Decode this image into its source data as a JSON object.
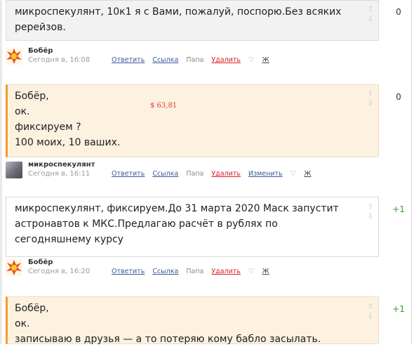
{
  "comments": [
    {
      "text_lines": [
        "микроспекулянт, 10к1 я с Вами, пожалуй, поспорю.Без всяких",
        "ререйзов."
      ],
      "score": "0"
    },
    {
      "author": "Бобёр",
      "date": "Сегодня в, 16:08",
      "actions": {
        "reply": "Ответить",
        "link": "Ссылка",
        "parent": "Папа",
        "delete": "Удалить",
        "like": "♡",
        "j": "Ж"
      }
    },
    {
      "text_lines": [
        "Бобёр,",
        "ок.",
        "фиксируем ?",
        "100 моих, 10 ваших."
      ],
      "money": "$ 63,81",
      "score": "0"
    },
    {
      "author": "микроспекулянт",
      "date": "Сегодня в, 16:11",
      "actions": {
        "reply": "Ответить",
        "link": "Ссылка",
        "parent": "Папа",
        "delete": "Удалить",
        "edit": "Изменить",
        "like": "♡",
        "j": "Ж"
      }
    },
    {
      "text_lines": [
        "микроспекулянт, фиксируем.До 31 марта 2020 Маск запустит",
        "астронавтов к МКС.Предлагаю расчёт в рублях по",
        "сегодняшнему курсу"
      ],
      "score": "+1"
    },
    {
      "author": "Бобёр",
      "date": "Сегодня в, 16:20",
      "actions": {
        "reply": "Ответить",
        "link": "Ссылка",
        "parent": "Папа",
        "delete": "Удалить",
        "like": "♡",
        "j": "Ж"
      }
    },
    {
      "text_lines": [
        "Бобёр,",
        "ок.",
        "записываю в друзья — а то потеряю кому бабло засылать."
      ],
      "score": "+1"
    }
  ],
  "icons": {
    "vote_up": "vote-up-icon",
    "vote_down": "vote-down-icon"
  },
  "colors": {
    "accent": "#f49b2a",
    "link": "#3b5998",
    "delete": "#d9202c",
    "plus": "#3c9a34",
    "money": "#e23b2b"
  }
}
